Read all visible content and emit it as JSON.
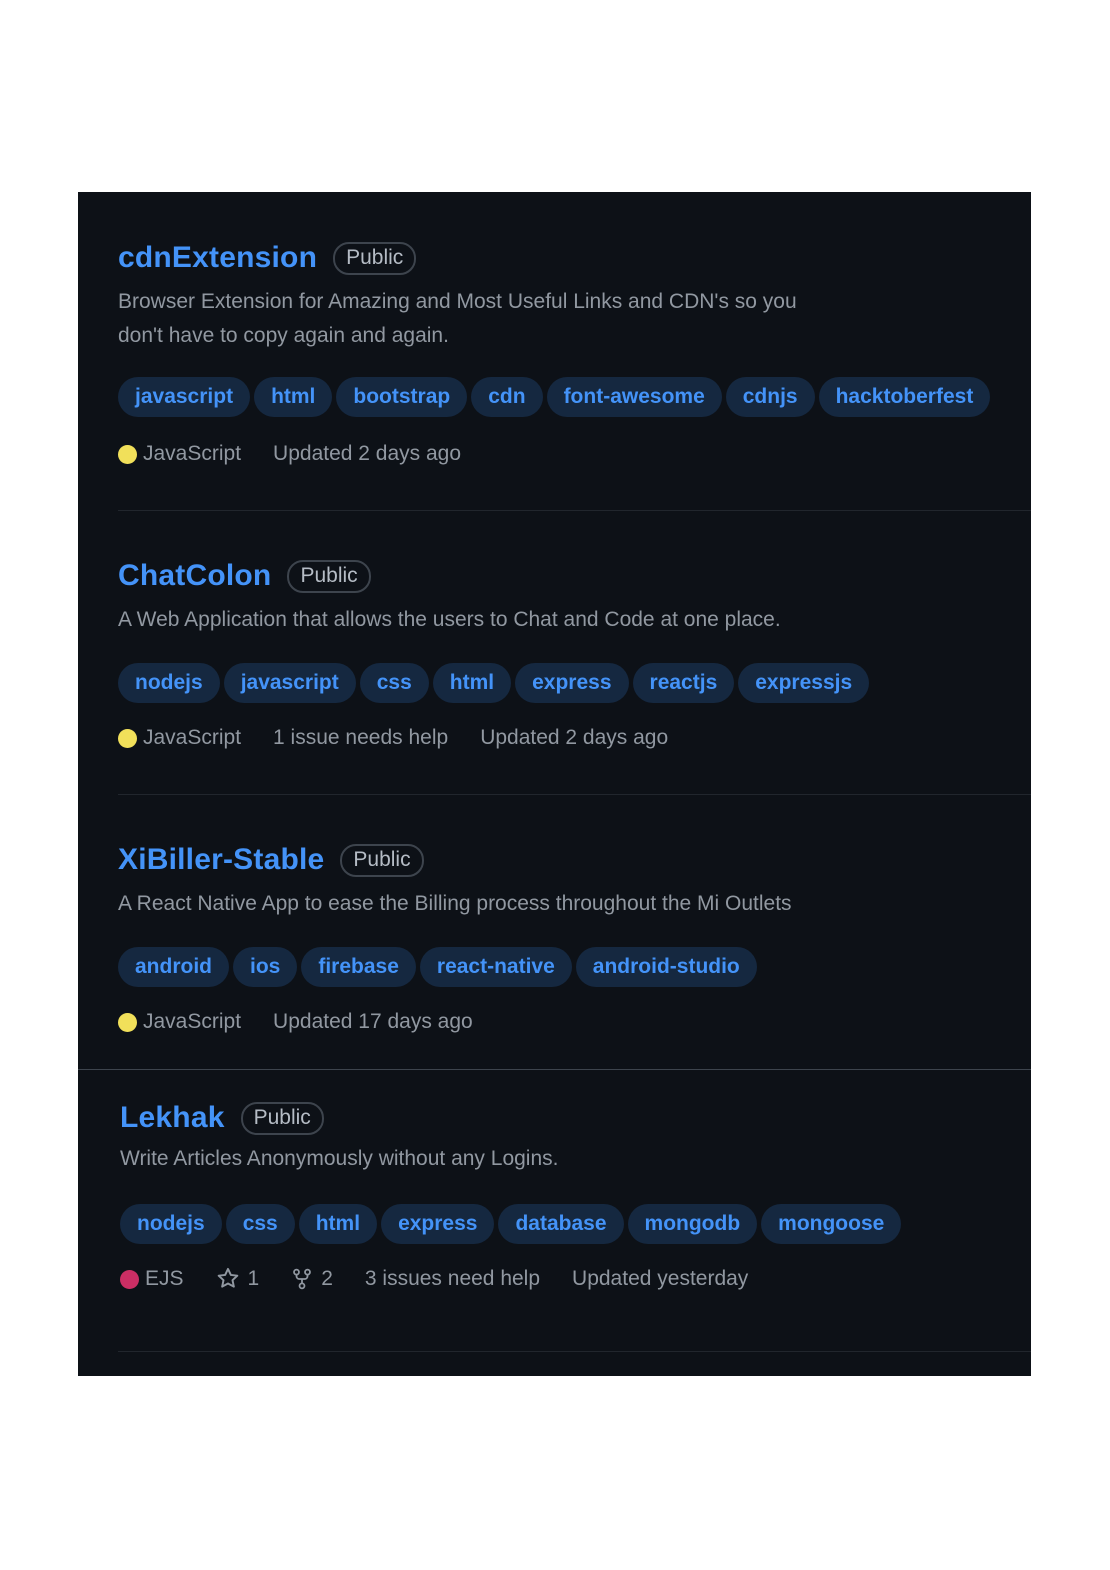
{
  "repos": [
    {
      "name": "cdnExtension",
      "visibility": "Public",
      "description": "Browser Extension for Amazing and Most Useful Links and CDN's so you don't have to copy again and again.",
      "topics": [
        "javascript",
        "html",
        "bootstrap",
        "cdn",
        "font-awesome",
        "cdnjs",
        "hacktoberfest"
      ],
      "language": "JavaScript",
      "language_color": "#f1e05a",
      "updated": "Updated 2 days ago"
    },
    {
      "name": "ChatColon",
      "visibility": "Public",
      "description": "A Web Application that allows the users to Chat and Code at one place.",
      "topics": [
        "nodejs",
        "javascript",
        "css",
        "html",
        "express",
        "reactjs",
        "expressjs"
      ],
      "language": "JavaScript",
      "language_color": "#f1e05a",
      "issues": "1 issue needs help",
      "updated": "Updated 2 days ago"
    },
    {
      "name": "XiBiller-Stable",
      "visibility": "Public",
      "description": "A React Native App to ease the Billing process throughout the Mi Outlets",
      "topics": [
        "android",
        "ios",
        "firebase",
        "react-native",
        "android-studio"
      ],
      "language": "JavaScript",
      "language_color": "#f1e05a",
      "updated": "Updated 17 days ago"
    },
    {
      "name": "Lekhak",
      "visibility": "Public",
      "description": "Write Articles Anonymously without any Logins.",
      "topics": [
        "nodejs",
        "css",
        "html",
        "express",
        "database",
        "mongodb",
        "mongoose"
      ],
      "language": "EJS",
      "language_color": "#cb2e64",
      "stars": "1",
      "forks": "2",
      "issues": "3 issues need help",
      "updated": "Updated yesterday"
    }
  ],
  "icons": {
    "star": "star-icon",
    "fork": "repo-forked-icon"
  }
}
